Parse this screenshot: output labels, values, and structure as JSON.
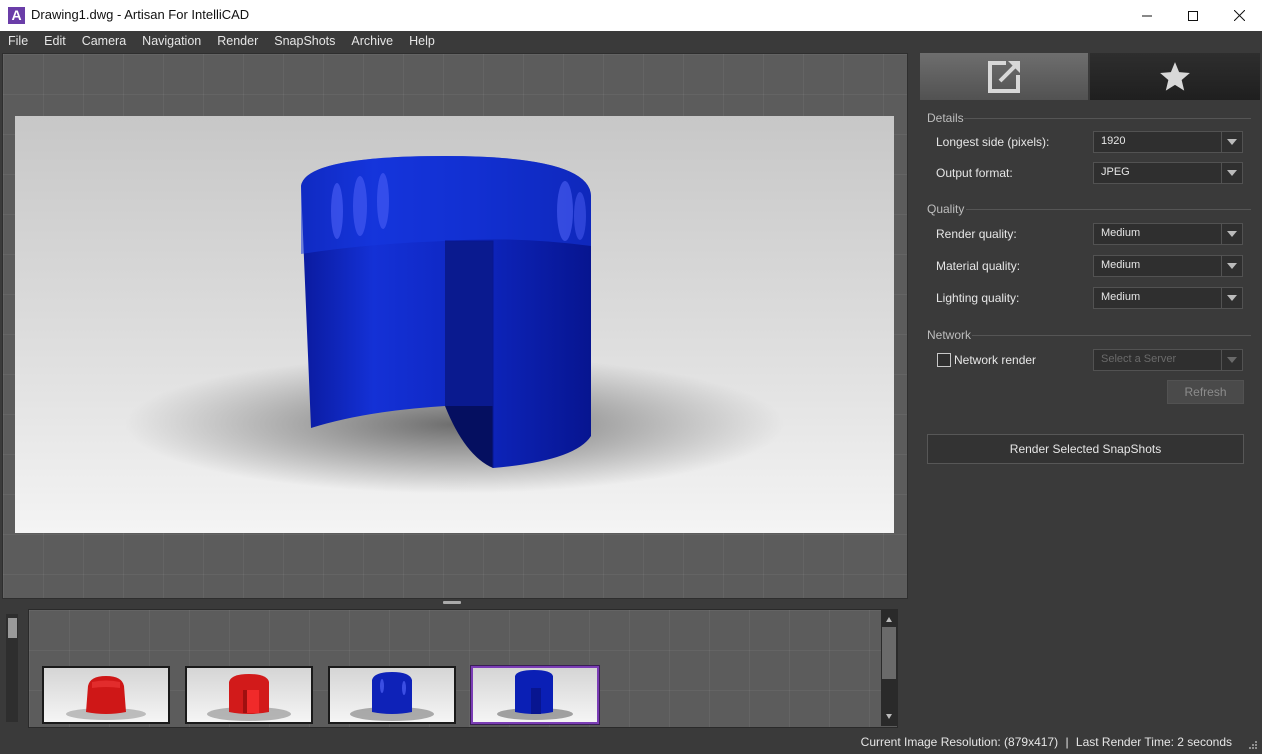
{
  "window": {
    "title": "Drawing1.dwg - Artisan For IntelliCAD",
    "logo_letter": "A"
  },
  "menu": [
    "File",
    "Edit",
    "Camera",
    "Navigation",
    "Render",
    "SnapShots",
    "Archive",
    "Help"
  ],
  "right_panel": {
    "tabs": [
      {
        "name": "export",
        "icon": "export-icon"
      },
      {
        "name": "favorites",
        "icon": "star-icon"
      }
    ],
    "details": {
      "title": "Details",
      "longest_side_label": "Longest side (pixels):",
      "longest_side_value": "1920",
      "output_format_label": "Output format:",
      "output_format_value": "JPEG"
    },
    "quality": {
      "title": "Quality",
      "render_label": "Render quality:",
      "render_value": "Medium",
      "material_label": "Material quality:",
      "material_value": "Medium",
      "lighting_label": "Lighting quality:",
      "lighting_value": "Medium"
    },
    "network": {
      "title": "Network",
      "checkbox_label": "Network render",
      "checked": false,
      "server_placeholder": "Select a Server",
      "refresh_label": "Refresh"
    },
    "render_button_label": "Render Selected SnapShots"
  },
  "snapshots": [
    {
      "color": "red",
      "selected": false
    },
    {
      "color": "red",
      "selected": false
    },
    {
      "color": "blue",
      "selected": false
    },
    {
      "color": "blue",
      "selected": true
    }
  ],
  "status": {
    "resolution": "Current Image Resolution: (879x417)",
    "separator": "|",
    "render_time": "Last Render Time: 2 seconds"
  },
  "colors": {
    "accent_selected": "#7b3db5",
    "model_blue": "#0a1fb5",
    "model_red": "#d41a1a"
  }
}
